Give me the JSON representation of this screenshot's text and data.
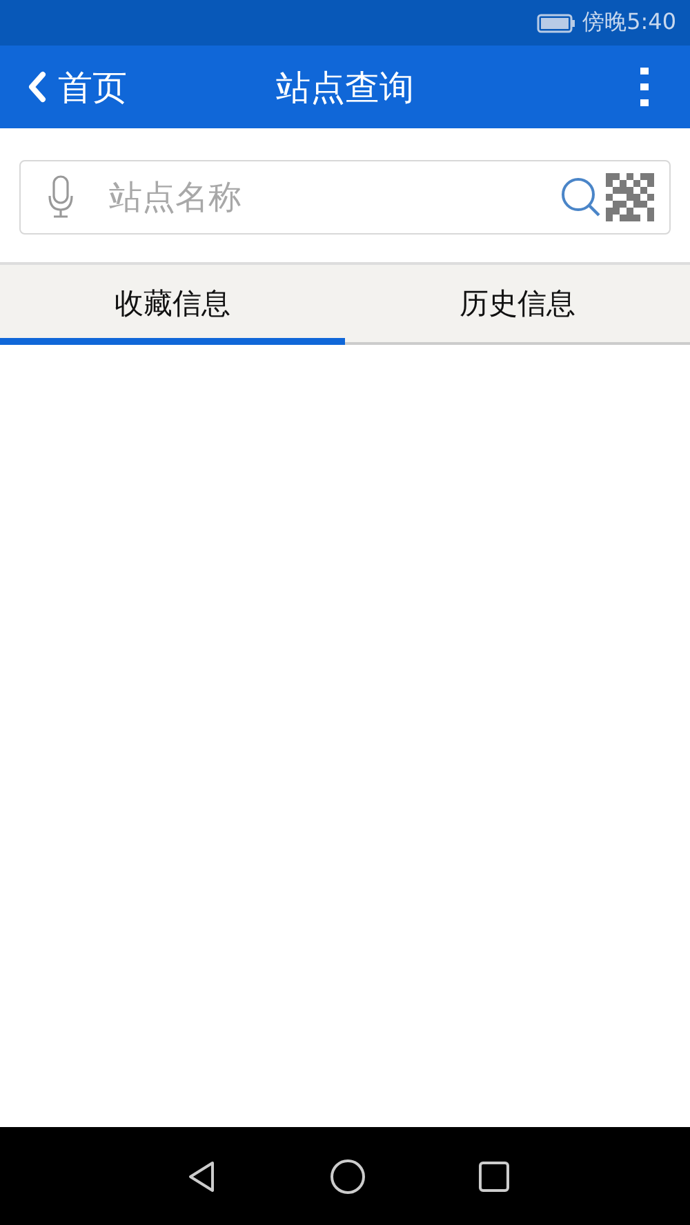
{
  "status_bar": {
    "time": "傍晚5:40"
  },
  "app_bar": {
    "back_label": "首页",
    "title": "站点查询"
  },
  "search": {
    "placeholder": "站点名称"
  },
  "tabs": [
    {
      "label": "收藏信息",
      "selected": true
    },
    {
      "label": "历史信息",
      "selected": false
    }
  ]
}
